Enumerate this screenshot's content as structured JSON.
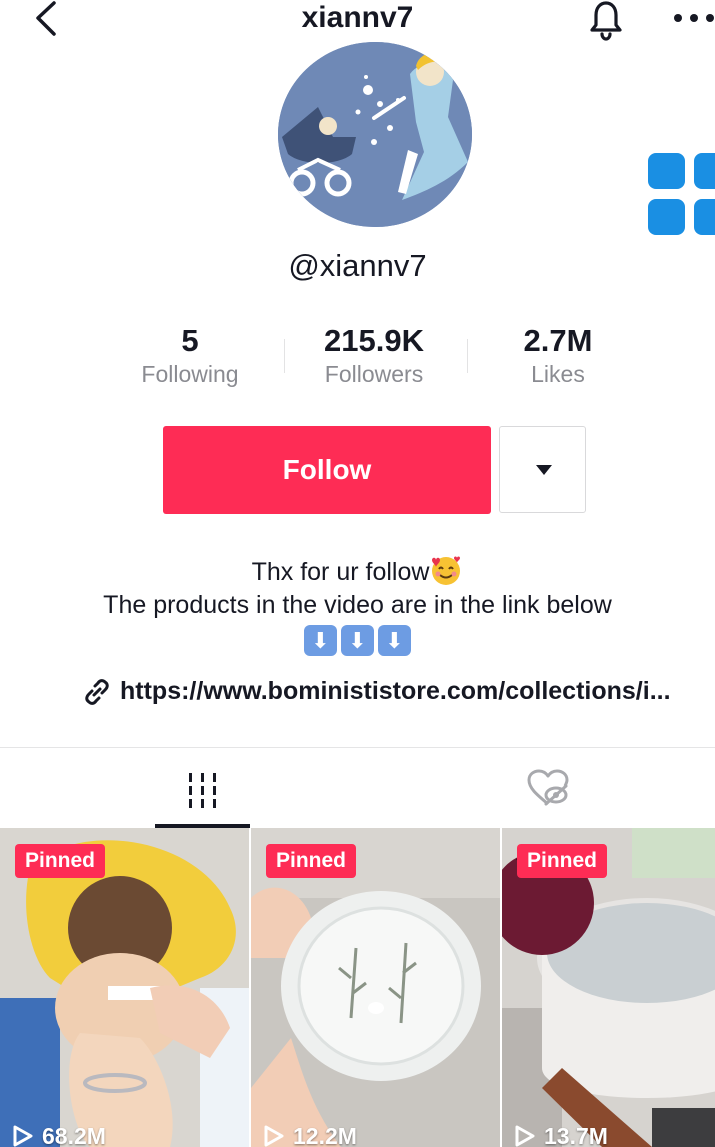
{
  "topbar": {
    "title": "xiannv7"
  },
  "profile": {
    "handle": "@xiannv7"
  },
  "stats": [
    {
      "value": "5",
      "label": "Following"
    },
    {
      "value": "215.9K",
      "label": "Followers"
    },
    {
      "value": "2.7M",
      "label": "Likes"
    }
  ],
  "actions": {
    "follow_label": "Follow"
  },
  "bio": {
    "line1": "Thx for ur follow",
    "line2": "The products in the video are in the link below",
    "arrows": [
      "⬇",
      "⬇",
      "⬇"
    ],
    "link": "https://www.bominististore.com/collections/i..."
  },
  "videos": [
    {
      "badge": "Pinned",
      "views": "68.2M"
    },
    {
      "badge": "Pinned",
      "views": "12.2M"
    },
    {
      "badge": "Pinned",
      "views": "13.7M"
    }
  ],
  "colors": {
    "accent": "#fe2c55",
    "brand_tile": "#1a8fe3",
    "avatar_bg": "#6f89b6"
  }
}
